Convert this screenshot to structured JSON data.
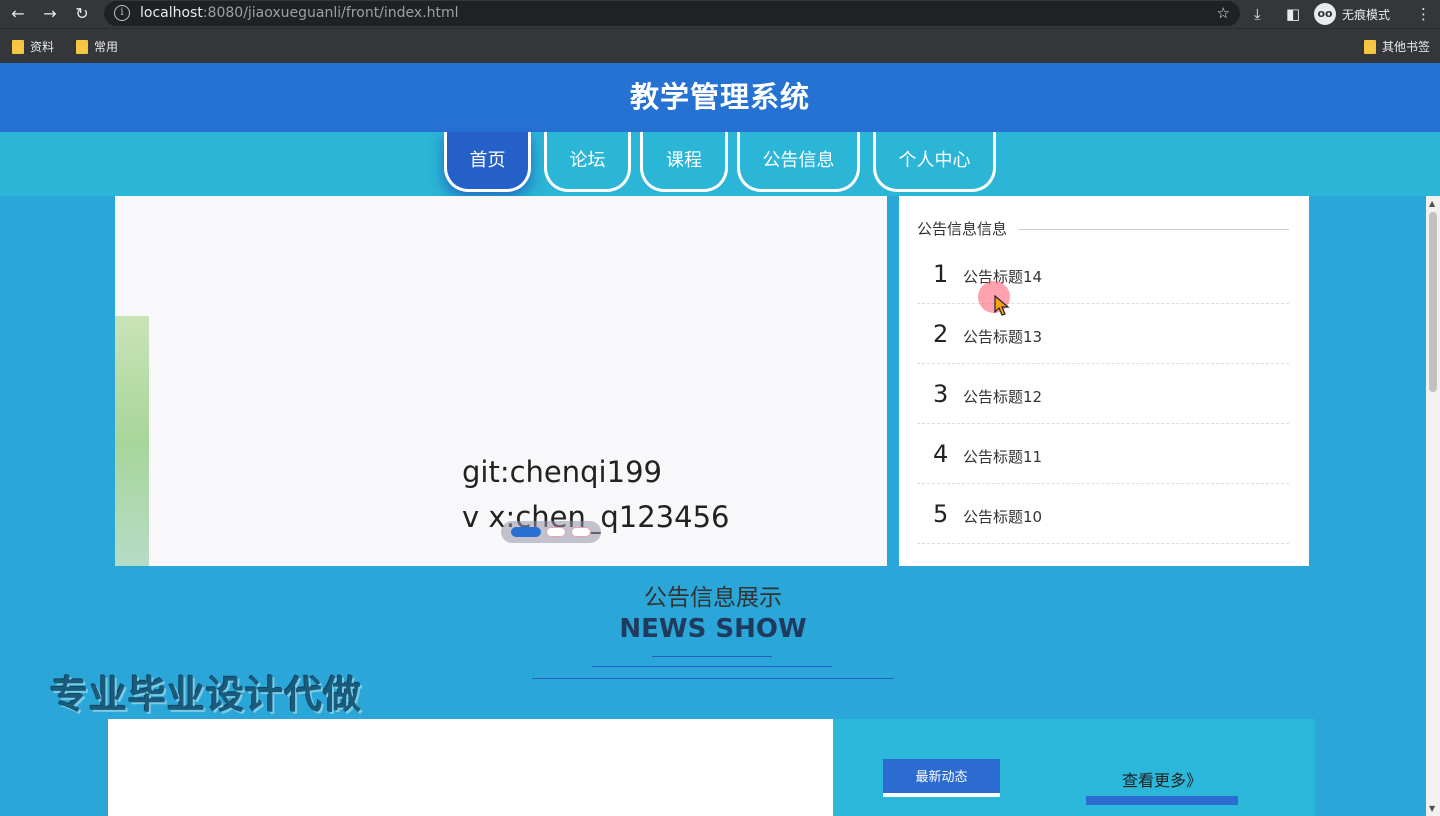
{
  "browser": {
    "url_host": "localhost",
    "url_rest": ":8080/jiaoxueguanli/front/index.html",
    "incognito_label": "无痕模式",
    "bookmarks": [
      "资料",
      "常用"
    ],
    "other_bookmarks": "其他书签"
  },
  "site": {
    "title": "教学管理系统",
    "nav": [
      "首页",
      "论坛",
      "课程",
      "公告信息",
      "个人中心"
    ],
    "active_nav": "首页"
  },
  "banner": {
    "line1": "git:chenqi199",
    "line2": "v x:chen_q123456"
  },
  "notice": {
    "heading": "公告信息信息",
    "items": [
      {
        "num": "1",
        "title": "公告标题14"
      },
      {
        "num": "2",
        "title": "公告标题13"
      },
      {
        "num": "3",
        "title": "公告标题12"
      },
      {
        "num": "4",
        "title": "公告标题11"
      },
      {
        "num": "5",
        "title": "公告标题10"
      }
    ]
  },
  "news": {
    "title_cn": "公告信息展示",
    "title_en": "NEWS SHOW",
    "latest_label": "最新动态",
    "more_label": "查看更多》"
  },
  "watermark": "专业毕业设计代做",
  "colors": {
    "header_blue": "#2672d3",
    "nav_cyan": "#2bb5d6",
    "active_tab": "#2460c8"
  }
}
